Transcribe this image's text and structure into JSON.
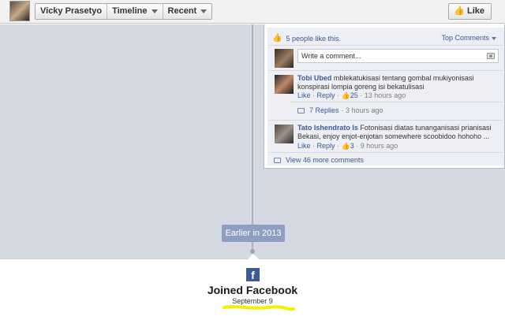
{
  "topbar": {
    "name": "Vicky Prasetyo",
    "timeline_label": "Timeline",
    "recent_label": "Recent",
    "like_label": "Like"
  },
  "panel": {
    "likes_text": "5 people like this.",
    "top_comments_label": "Top Comments",
    "composer_placeholder": "Write a comment...",
    "comments": [
      {
        "author": "Tobi Ubed",
        "text": "mblekatukisasi tentang gombal mukiyonisasi konspirasi lompia goreng isi bekatulisasi",
        "like": "Like",
        "reply": "Reply",
        "likes": "25",
        "time": "13 hours ago",
        "replies_label": "7 Replies",
        "replies_time": "3 hours ago"
      },
      {
        "author": "Tato Ishendrato Is",
        "text": "Fotonisasi diatas tunanganisasi prianisasi Bekasi, enjoy enjot-enjotan somewhere scoobidoo hohoho ...",
        "like": "Like",
        "reply": "Reply",
        "likes": "3",
        "time": "9 hours ago"
      }
    ],
    "more_comments": "View 46 more comments"
  },
  "timeline": {
    "earlier_label": "Earlier in 2013"
  },
  "joined": {
    "logo_letter": "f",
    "title": "Joined Facebook",
    "date": "September 9"
  },
  "colors": {
    "facebook_blue": "#3b5998",
    "timeline_bg": "#d4d9e2",
    "highlight": "#f2f200"
  }
}
